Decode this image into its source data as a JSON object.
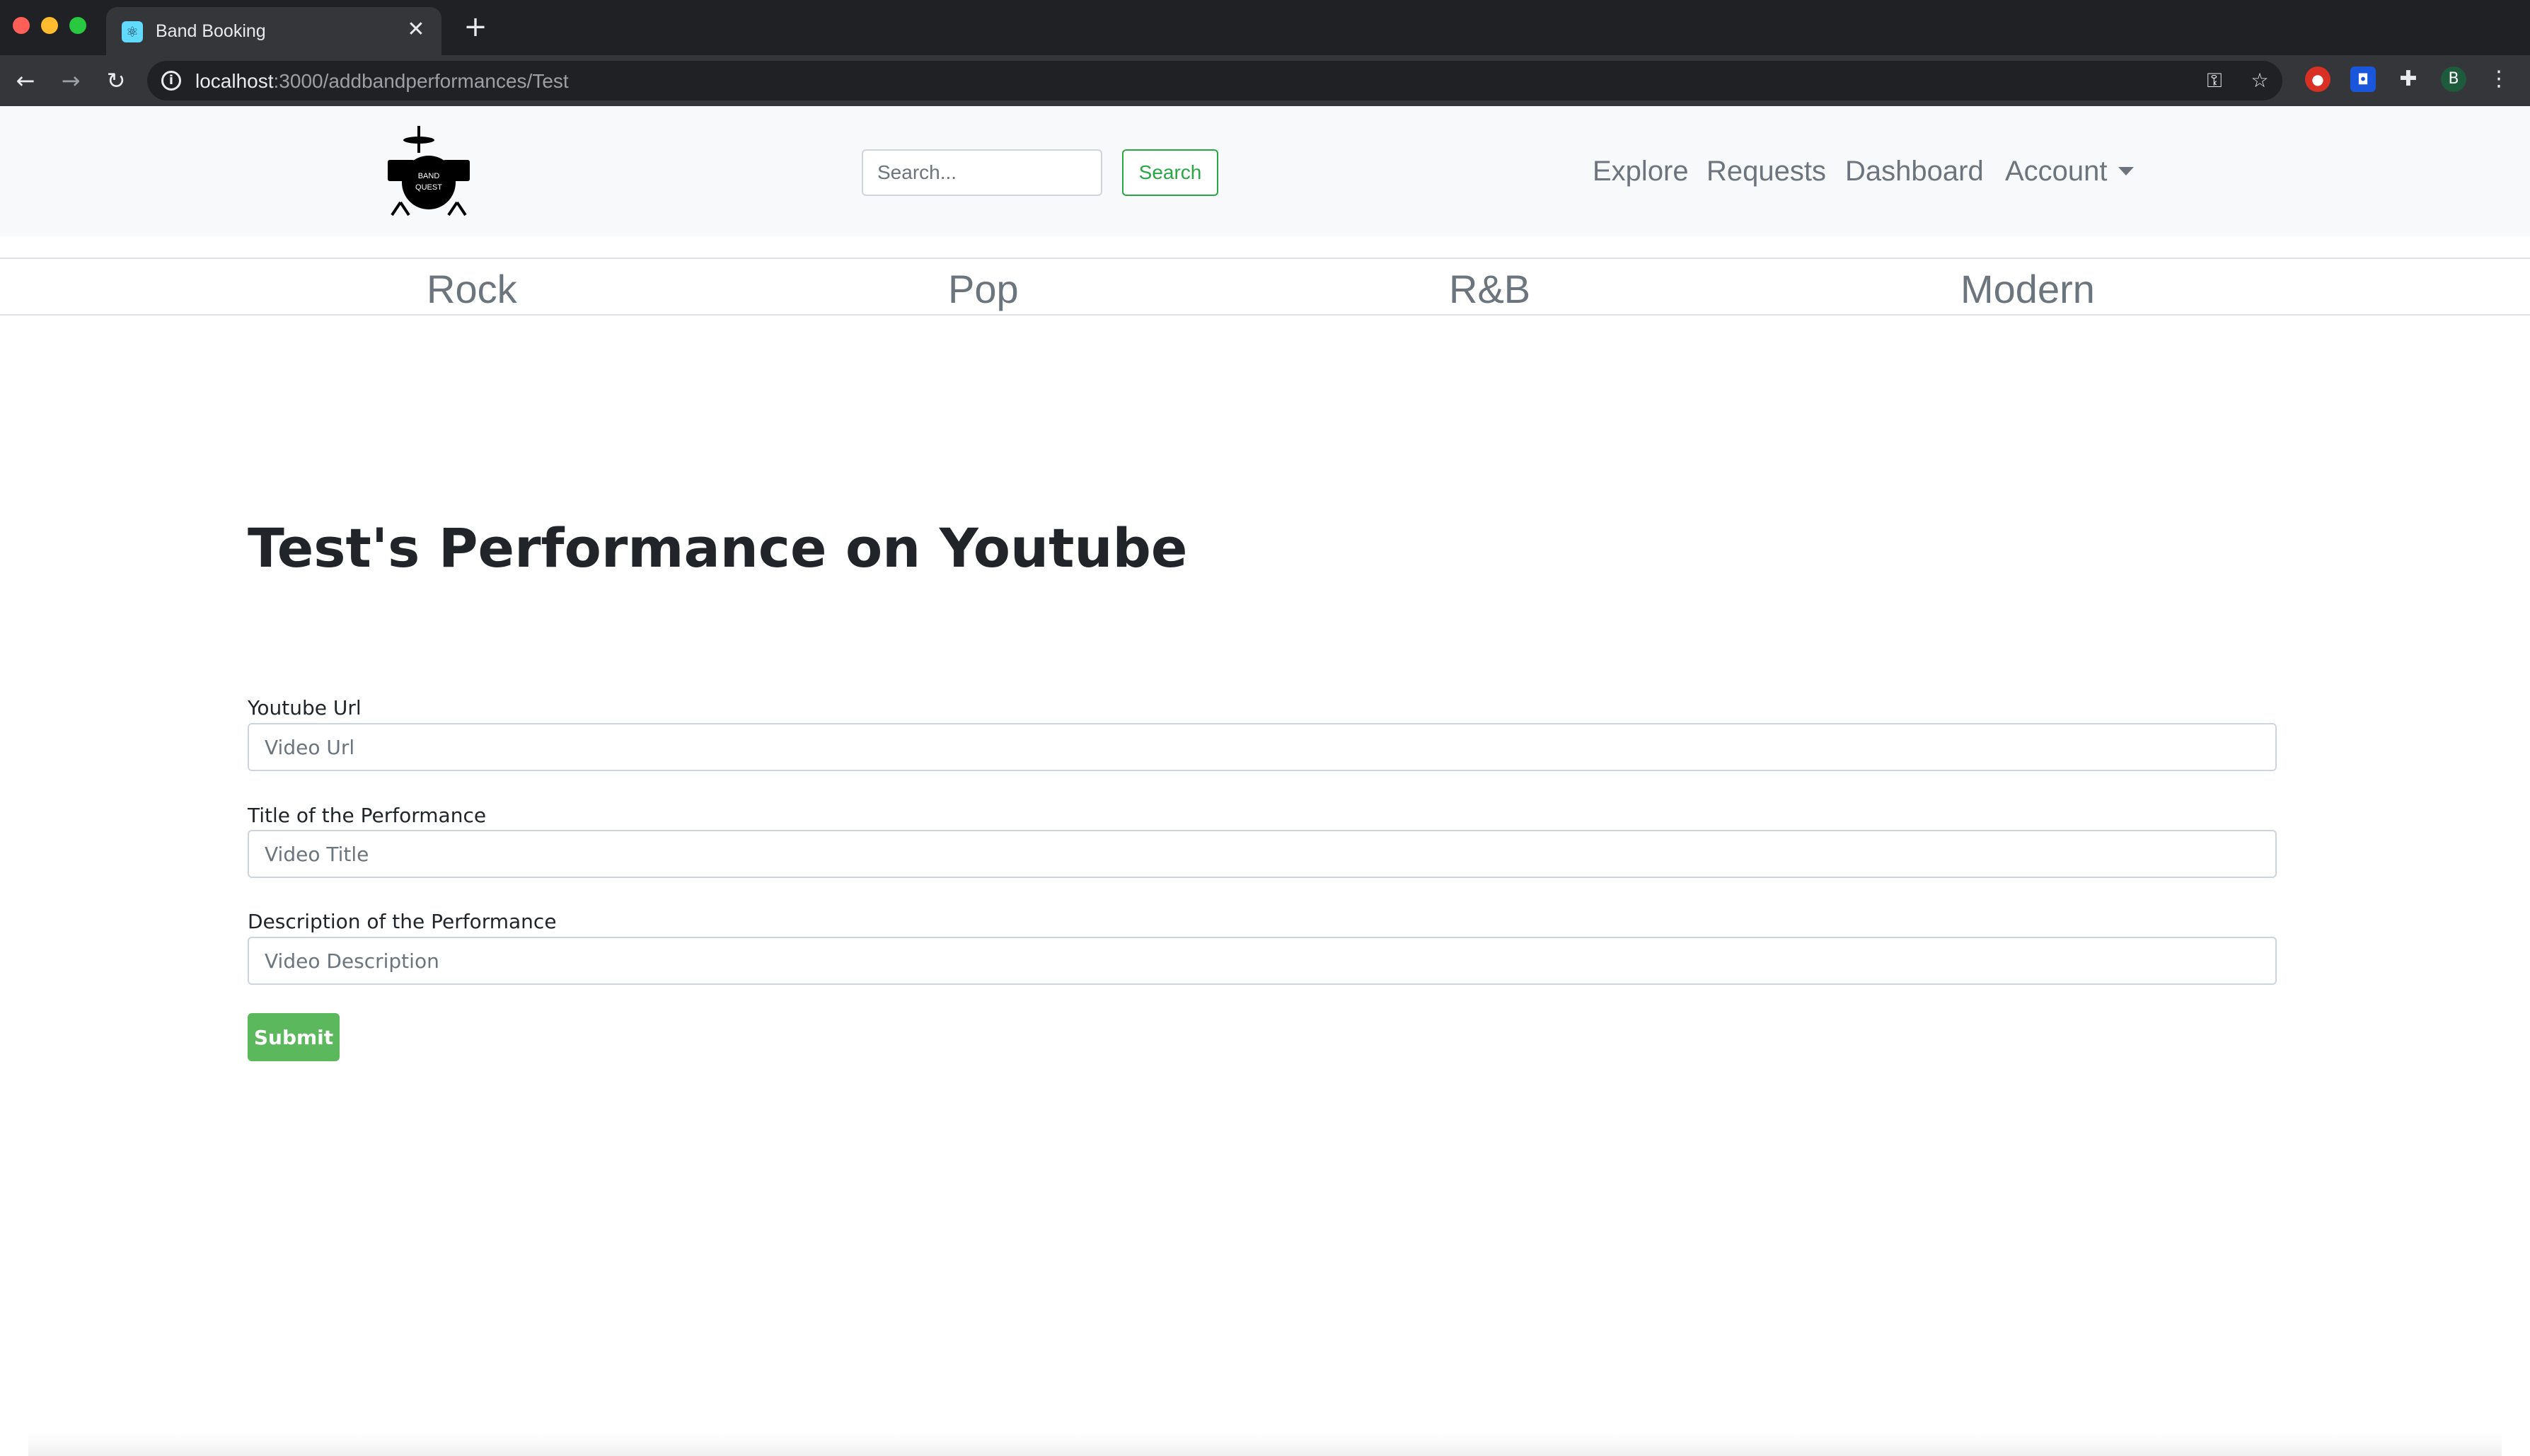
{
  "browser": {
    "tab_title": "Band Booking",
    "tab_close": "✕",
    "new_tab": "+",
    "url_host": "localhost",
    "url_path": ":3000/addbandperformances/Test",
    "profile_initial": "B"
  },
  "navbar": {
    "logo_text_line1": "BAND",
    "logo_text_line2": "QUEST",
    "search_placeholder": "Search...",
    "search_button": "Search",
    "links": {
      "explore": "Explore",
      "requests": "Requests",
      "dashboard": "Dashboard",
      "account": "Account"
    }
  },
  "genres": [
    "Rock",
    "Pop",
    "R&B",
    "Modern"
  ],
  "form": {
    "heading": "Test's Performance on Youtube",
    "fields": [
      {
        "label": "Youtube Url",
        "placeholder": "Video Url",
        "value": ""
      },
      {
        "label": "Title of the Performance",
        "placeholder": "Video Title",
        "value": ""
      },
      {
        "label": "Description of the Performance",
        "placeholder": "Video Description",
        "value": ""
      }
    ],
    "submit_label": "Submit"
  },
  "colors": {
    "navbar_bg": "#f8f9fa",
    "search_green": "#28a745",
    "submit_green": "#5cb85c",
    "link_gray": "#6c757d",
    "chrome_dark": "#202124"
  }
}
